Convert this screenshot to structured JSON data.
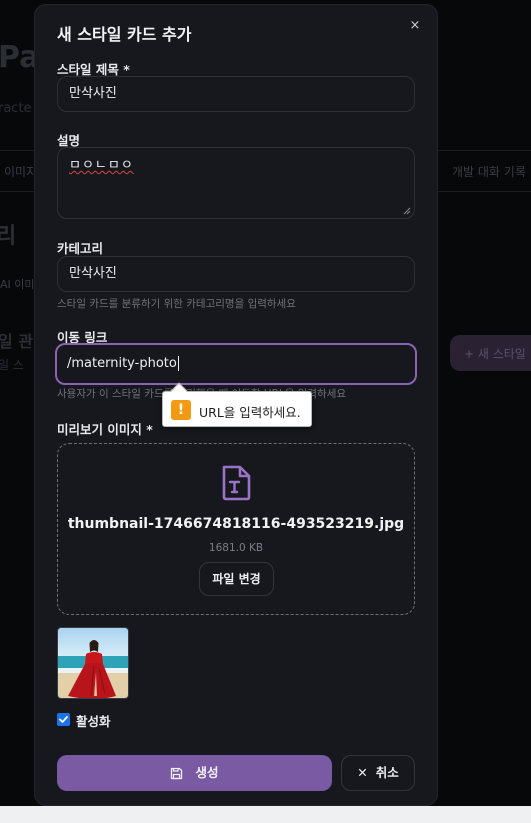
{
  "background": {
    "title_fragment": "Pa",
    "subtitle_fragment": "racte",
    "tab_left_fragment": "이미지",
    "tab_right_fragment": "개발 대화 기록",
    "heading_fragment": "리",
    "chip_fragment": "AI 이미",
    "section_fragment": "일 관리",
    "section_sub_fragment": "일 스",
    "add_button_fragment": "+ 새 스타일"
  },
  "modal": {
    "title": "새 스타일 카드 추가",
    "close_label": "×",
    "fields": {
      "title": {
        "label": "스타일 제목 *",
        "value": "만삭사진"
      },
      "description": {
        "label": "설명",
        "value": "ㅁㅇㄴㅁㅇ"
      },
      "category": {
        "label": "카테고리",
        "value": "만삭사진",
        "help": "스타일 카드를 분류하기 위한 카테고리명을 입력하세요"
      },
      "link": {
        "label": "이동 링크",
        "value": "/maternity-photo",
        "help": "사용자가 이 스타일 카드를 클릭했을 때 이동할 URL을 입력하세요"
      }
    },
    "tooltip": {
      "text": "URL을 입력하세요.",
      "icon": "warning-icon",
      "icon_color": "#f29b12"
    },
    "preview": {
      "label": "미리보기 이미지 *",
      "file_name": "thumbnail-1746674818116-493523219.jpg",
      "file_size": "1681.0 KB",
      "change_label": "파일 변경",
      "icon": "file-text-icon",
      "accent": "#9b72c9"
    },
    "active": {
      "label": "활성화",
      "checked": true
    },
    "actions": {
      "create_label": "생성",
      "cancel_label": "취소",
      "create_color": "#7a5aa3"
    }
  }
}
